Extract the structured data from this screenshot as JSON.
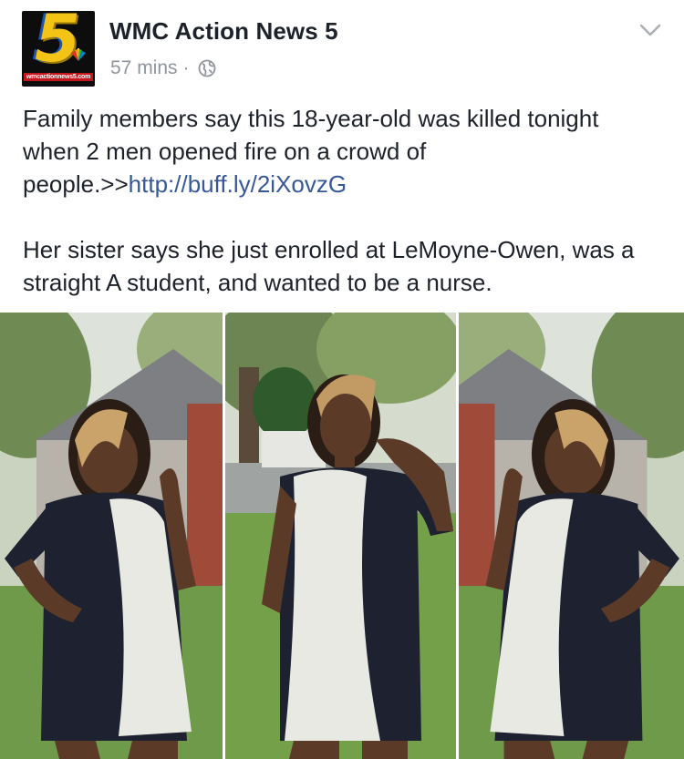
{
  "post": {
    "page_name": "WMC Action News 5",
    "avatar": {
      "number": "5",
      "site_text": "wmcactionnews5.com",
      "brand_colors": {
        "gold": "#f3c316",
        "blue": "#1b56b5",
        "red": "#c4161c"
      }
    },
    "timestamp": "57 mins",
    "separator": "·",
    "privacy_icon": "globe-icon",
    "options_icon": "chevron-down-icon",
    "message": {
      "paragraph1_text": "Family members say this 18-year-old was killed tonight when 2 men opened fire on a crowd of people.>>",
      "paragraph1_link": "http://buff.ly/2iXovzG",
      "paragraph2_text": "Her sister says she just enrolled at LeMoyne-Owen, was a straight A student, and wanted to be a nurse."
    },
    "photo": {
      "panel_count": 3
    }
  },
  "colors": {
    "text": "#1d2129",
    "meta": "#90949c",
    "link": "#365899"
  }
}
